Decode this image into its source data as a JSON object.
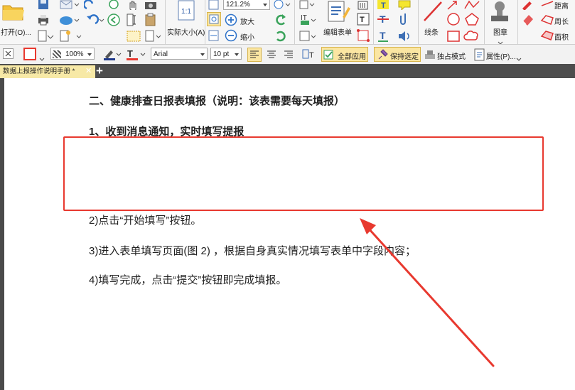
{
  "toolbar": {
    "open_label": "打开(O)...",
    "actual_size_label": "实际大小(A)",
    "zoom_in_label": "放大",
    "zoom_out_label": "缩小",
    "zoom_value": "121.2%",
    "edit_form_label": "编辑表单",
    "line_label": "线条",
    "stamp_label": "图章",
    "distance_label": "距离",
    "perimeter_label": "周长",
    "area_label": "面积"
  },
  "format_bar": {
    "opacity_value": "100%",
    "font_value": "Arial",
    "size_value": "10 pt",
    "apply_all_label": "全部应用",
    "keep_selected_label": "保持选定",
    "exclusive_mode_label": "独占模式",
    "properties_label": "属性(P)..."
  },
  "tabs": [
    {
      "label": "数据上报操作说明手册 *",
      "close": "✕"
    }
  ],
  "new_tab_symbol": "+",
  "document": {
    "heading": "二、健康排查日报表填报（说明：该表需要每天填报）",
    "step1": "1、收到消息通知，实时填写提报",
    "step2": "2)点击“开始填写”按钮。",
    "step3": "3)进入表单填写页面(图 2) ，根据自身真实情况填写表单中字段内容；",
    "step4": "4)填写完成，点击“提交”按钮即完成填报。"
  },
  "colors": {
    "annotation_red": "#e8392f",
    "tab_bg": "#f7e9a6",
    "active_button_bg": "#fbe6a2",
    "ribbon_bg": "#f6f6f6"
  }
}
